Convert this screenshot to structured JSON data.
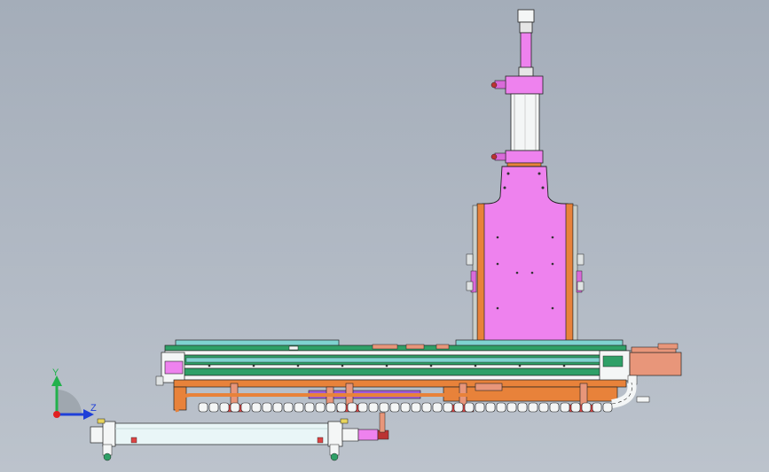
{
  "viewport": {
    "background_top": "#a4adb9",
    "background_bottom": "#bcc3cc"
  },
  "model": {
    "parts": [
      "cylinder-rod-cap",
      "vertical-cylinder",
      "vertical-slide-carriage",
      "horizontal-rail-base",
      "servo-motor",
      "cable-drag-chain",
      "horizontal-air-cylinder"
    ],
    "colors": {
      "magenta": "#ee82ee",
      "orange": "#e8823a",
      "green": "#2fa067",
      "cyan": "#7fd3d0",
      "salmon": "#e8967a",
      "purple": "#a25bd6",
      "white": "#f4f6f6"
    }
  },
  "triad": {
    "x_label": "X",
    "y_label": "Y",
    "z_label": "Z",
    "y_color": "#22b14c",
    "z_color": "#1f3fd8",
    "origin_color": "#e02020"
  }
}
